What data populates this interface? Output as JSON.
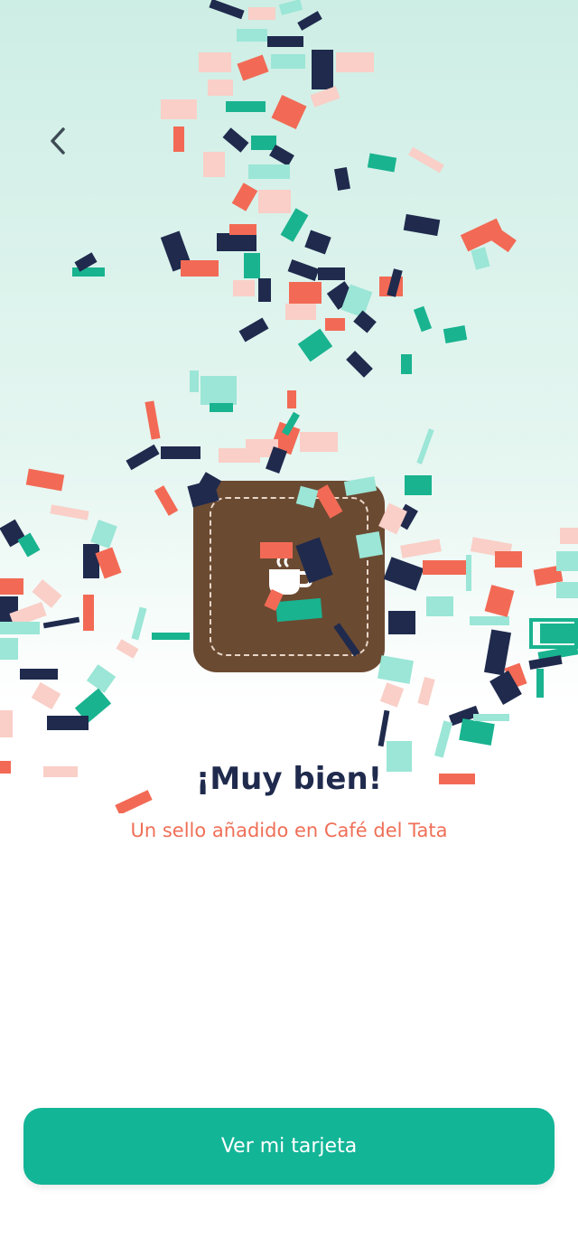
{
  "header": {
    "back_icon": "chevron-left-icon"
  },
  "stamp": {
    "icon": "coffee-cup-icon",
    "card_color": "#6b4a32"
  },
  "message": {
    "title": "¡Muy bien!",
    "subtitle": "Un sello añadido en Café del Tata"
  },
  "actions": {
    "primary_label": "Ver mi tarjeta"
  },
  "colors": {
    "accent": "#13b597",
    "title": "#1f2a4d",
    "subtitle": "#ef6f57",
    "confetti": [
      "#1f2a4d",
      "#f26a55",
      "#9be6d6",
      "#f9cfc7",
      "#19b38f"
    ]
  }
}
